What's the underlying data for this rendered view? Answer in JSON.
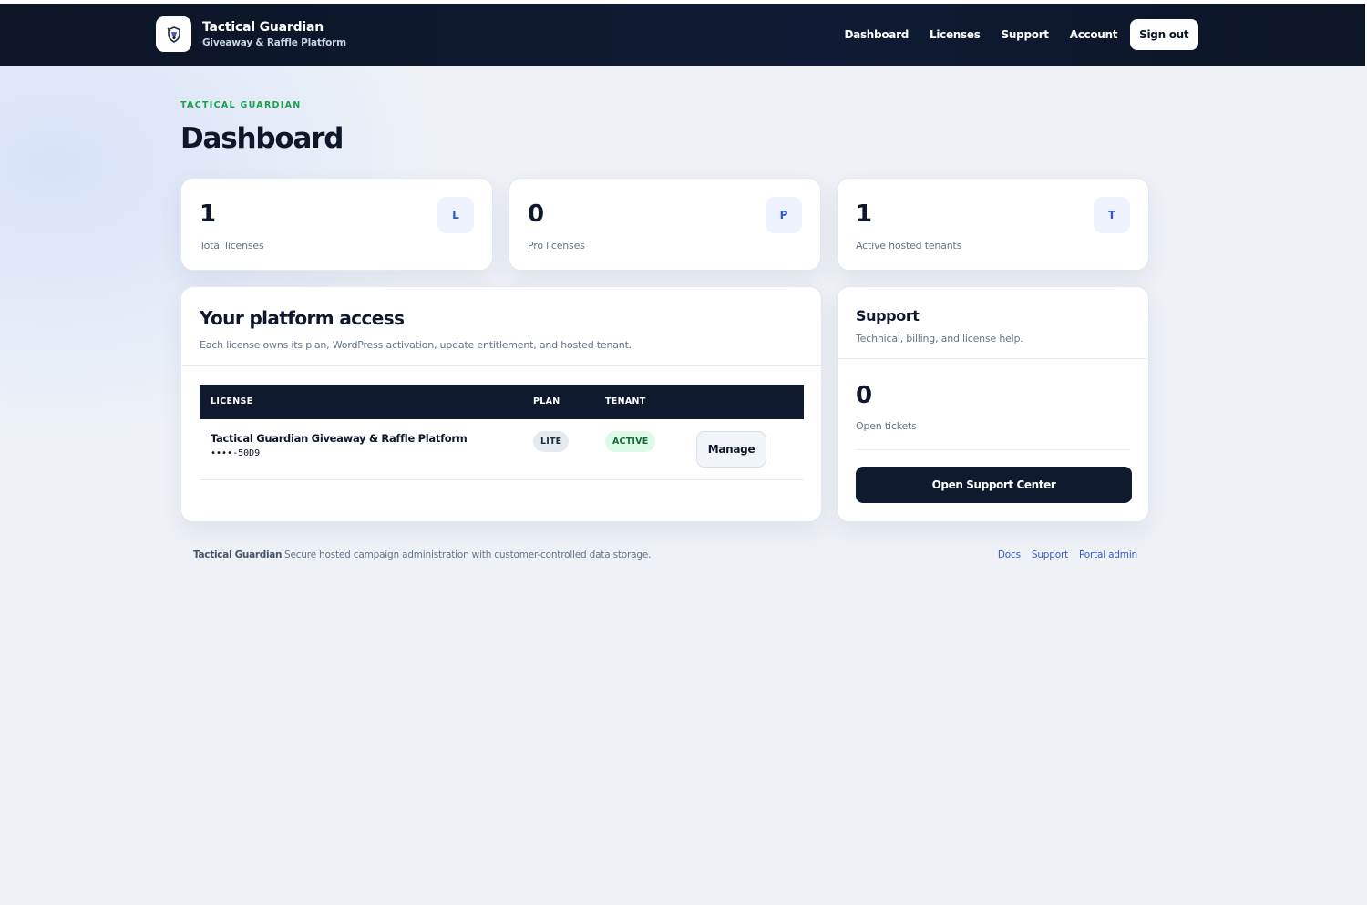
{
  "header": {
    "brand_title": "Tactical Guardian",
    "brand_subtitle": "Giveaway & Raffle Platform",
    "logo_icon": "shield-knight-icon",
    "nav": [
      "Dashboard",
      "Licenses",
      "Support",
      "Account"
    ],
    "sign_out_label": "Sign out"
  },
  "page": {
    "eyebrow": "TACTICAL GUARDIAN",
    "title": "Dashboard"
  },
  "stats": [
    {
      "value": "1",
      "label": "Total licenses",
      "badge": "L"
    },
    {
      "value": "0",
      "label": "Pro licenses",
      "badge": "P"
    },
    {
      "value": "1",
      "label": "Active hosted tenants",
      "badge": "T"
    }
  ],
  "access": {
    "title": "Your platform access",
    "subtitle": "Each license owns its plan, WordPress activation, update entitlement, and hosted tenant.",
    "columns": [
      "LICENSE",
      "PLAN",
      "TENANT"
    ],
    "rows": [
      {
        "name": "Tactical Guardian Giveaway & Raffle Platform",
        "key": "••••-50D9",
        "plan": "LITE",
        "tenant": "ACTIVE",
        "action": "Manage"
      }
    ]
  },
  "support": {
    "title": "Support",
    "subtitle": "Technical, billing, and license help.",
    "open_tickets": "0",
    "open_tickets_label": "Open tickets",
    "button_label": "Open Support Center"
  },
  "footer": {
    "brand": "Tactical Guardian",
    "text": "Secure hosted campaign administration with customer-controlled data storage.",
    "links": [
      "Docs",
      "Support",
      "Portal admin"
    ]
  },
  "colors": {
    "navy": "#0f1a2e",
    "accent_green": "#17a34a",
    "accent_blue": "#2f55d4",
    "background": "#eef2f7"
  }
}
